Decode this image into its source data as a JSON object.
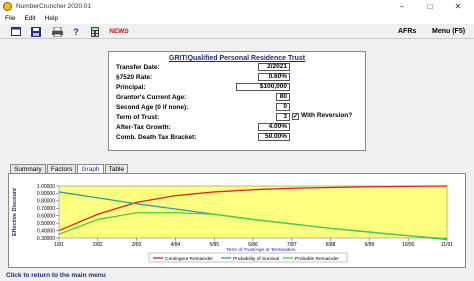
{
  "window": {
    "title": "NumberCruncher 2020.01"
  },
  "menu": {
    "items": [
      "File",
      "Edit",
      "Help"
    ]
  },
  "toolbar": {
    "news_label": "NEWS",
    "afrs_label": "AFRs",
    "menu_label": "Menu (F5)"
  },
  "form": {
    "title": "GRIT/Qualified Personal Residence Trust",
    "fields": [
      {
        "label": "Transfer Date:",
        "value": "2/2021"
      },
      {
        "label": "§7520 Rate:",
        "value": "0.60%"
      },
      {
        "label": "Principal:",
        "value": "$100,000"
      },
      {
        "label": "Grantor's Current Age:",
        "value": "80"
      },
      {
        "label": "Second Age (0 if none):",
        "value": "0"
      },
      {
        "label": "Term of Trust:",
        "value": "3"
      },
      {
        "label": "After-Tax Growth:",
        "value": "4.00%"
      },
      {
        "label": "Comb. Death Tax Bracket:",
        "value": "50.00%"
      }
    ],
    "reversion_label": "With Reversion?",
    "reversion_checked": true
  },
  "tabs": [
    "Summary",
    "Factors",
    "Graph",
    "Table"
  ],
  "active_tab": "Graph",
  "status": {
    "text": "Click to return to the main menu"
  },
  "chart_data": {
    "type": "line",
    "ylabel": "Effective Discount",
    "xlabel": "Term of Trust/Age at Termination",
    "categories": [
      "1/81",
      "2/82",
      "3/83",
      "4/84",
      "5/85",
      "6/86",
      "7/87",
      "8/88",
      "9/89",
      "10/90",
      "11/91"
    ],
    "ylim": [
      0.3,
      1.0
    ],
    "yticks": [
      "1.00000",
      "0.90000",
      "0.80000",
      "0.70000",
      "0.60000",
      "0.50000",
      "0.40000",
      "0.30000"
    ],
    "xlabel_index_display": "6/86",
    "series": [
      {
        "name": "Contingent Remainder",
        "color": "#e02020",
        "values": [
          0.4,
          0.62,
          0.78,
          0.87,
          0.92,
          0.95,
          0.97,
          0.98,
          0.99,
          0.995,
          1.0
        ]
      },
      {
        "name": "Probability of Survival",
        "color": "#20a0b0",
        "values": [
          0.92,
          0.84,
          0.76,
          0.69,
          0.62,
          0.55,
          0.49,
          0.43,
          0.38,
          0.33,
          0.28
        ]
      },
      {
        "name": "Probable Remainder",
        "color": "#40d040",
        "values": [
          0.35,
          0.55,
          0.64,
          0.64,
          0.62,
          0.55,
          0.49,
          0.43,
          0.38,
          0.33,
          0.29
        ]
      }
    ],
    "background": "#ffff80",
    "grid": false
  }
}
